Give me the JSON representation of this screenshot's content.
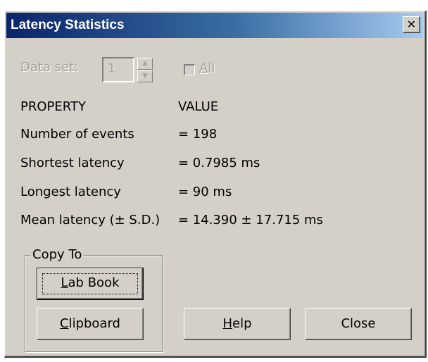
{
  "window": {
    "title": "Latency Statistics",
    "close_glyph": "✕"
  },
  "dataset": {
    "label_first": "D",
    "label_rest": "ata set:",
    "value": "1",
    "all_first": "A",
    "all_rest": "ll"
  },
  "table": {
    "header_property": "PROPERTY",
    "header_value": "VALUE",
    "rows": [
      {
        "property": "Number of events",
        "value": "= 198"
      },
      {
        "property": "Shortest latency",
        "value": "= 0.7985 ms"
      },
      {
        "property": "Longest latency",
        "value": "= 90 ms"
      },
      {
        "property": "Mean latency (± S.D.)",
        "value": "= 14.390 ± 17.715 ms"
      }
    ]
  },
  "copy_to": {
    "label": "Copy To",
    "lab_book_first": "L",
    "lab_book_rest": "ab Book",
    "clipboard_first": "C",
    "clipboard_rest": "lipboard"
  },
  "buttons": {
    "help_first": "H",
    "help_rest": "elp",
    "close": "Close"
  },
  "colors": {
    "title_start": "#0a246a",
    "title_end": "#a6caf0",
    "face": "#d4d0c8"
  },
  "icons": {
    "close": "close-icon",
    "spin_up": "chevron-up-icon",
    "spin_down": "chevron-down-icon"
  }
}
